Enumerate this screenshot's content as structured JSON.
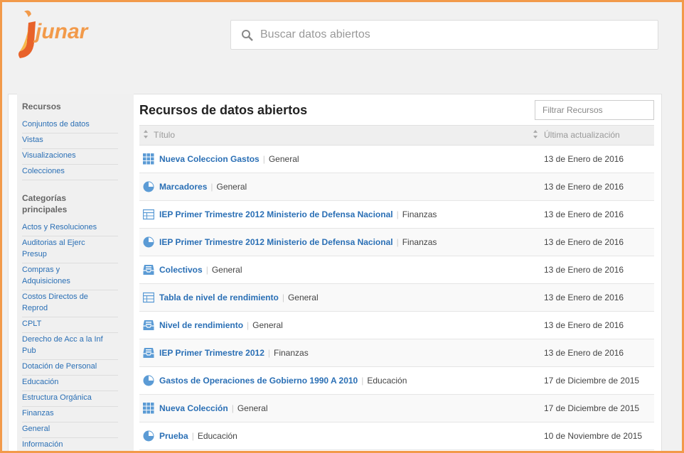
{
  "header": {
    "logo_text": "junar",
    "search_placeholder": "Buscar datos abiertos"
  },
  "sidebar": {
    "section1_title": "Recursos",
    "resources": [
      "Conjuntos de datos",
      "Vistas",
      "Visualizaciones",
      "Colecciones"
    ],
    "section2_title_line1": "Categorías",
    "section2_title_line2": "principales",
    "categories": [
      [
        "Actos y Resoluciones"
      ],
      [
        "Auditorias al Ejerc",
        "Presup"
      ],
      [
        "Compras y",
        "Adquisiciones"
      ],
      [
        "Costos Directos de",
        "Reprod"
      ],
      [
        "CPLT"
      ],
      [
        "Derecho de Acc a la Inf",
        "Pub"
      ],
      [
        "Dotación de Personal"
      ],
      [
        "Educación"
      ],
      [
        "Estructura Orgánica"
      ],
      [
        "Finanzas"
      ],
      [
        "General"
      ],
      [
        "Información"
      ]
    ]
  },
  "main": {
    "title": "Recursos de datos abiertos",
    "filter_placeholder": "Filtrar Recursos",
    "col_title": "Título",
    "col_updated": "Última actualización",
    "rows": [
      {
        "icon": "grid",
        "name": "Nueva Coleccion Gastos",
        "category": "General",
        "date": "13 de Enero de 2016"
      },
      {
        "icon": "pie",
        "name": "Marcadores",
        "category": "General",
        "date": "13 de Enero de 2016"
      },
      {
        "icon": "table",
        "name": "IEP Primer Trimestre 2012 Ministerio de Defensa Nacional",
        "category": "Finanzas",
        "date": "13 de Enero de 2016"
      },
      {
        "icon": "pie",
        "name": "IEP Primer Trimestre 2012 Ministerio de Defensa Nacional",
        "category": "Finanzas",
        "date": "13 de Enero de 2016"
      },
      {
        "icon": "inbox",
        "name": "Colectivos",
        "category": "General",
        "date": "13 de Enero de 2016"
      },
      {
        "icon": "table",
        "name": "Tabla de nivel de rendimiento",
        "category": "General",
        "date": "13 de Enero de 2016"
      },
      {
        "icon": "inbox",
        "name": "Nivel de rendimiento",
        "category": "General",
        "date": "13 de Enero de 2016"
      },
      {
        "icon": "inbox",
        "name": "IEP Primer Trimestre 2012",
        "category": "Finanzas",
        "date": "13 de Enero de 2016"
      },
      {
        "icon": "pie",
        "name": "Gastos de Operaciones de Gobierno 1990 A 2010",
        "category": "Educación",
        "date": "17 de Diciembre de 2015"
      },
      {
        "icon": "grid",
        "name": "Nueva Colección",
        "category": "General",
        "date": "17 de Diciembre de 2015"
      },
      {
        "icon": "pie",
        "name": "Prueba",
        "category": "Educación",
        "date": "10 de Noviembre de 2015"
      }
    ]
  },
  "colors": {
    "accent": "#f29a4a",
    "link": "#2a6fb5",
    "icon": "#5b9bd5"
  }
}
